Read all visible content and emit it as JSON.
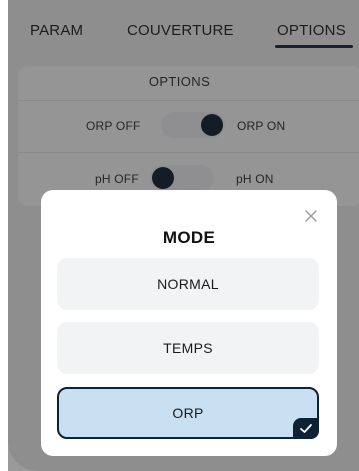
{
  "tabs": [
    {
      "label": "PARAM",
      "active": false
    },
    {
      "label": "COUVERTURE",
      "active": false
    },
    {
      "label": "OPTIONS",
      "active": true
    }
  ],
  "options": {
    "title": "OPTIONS",
    "orp": {
      "off_label": "ORP OFF",
      "on_label": "ORP ON",
      "state": "on"
    },
    "ph": {
      "off_label": "pH OFF",
      "on_label": "pH ON",
      "state": "off"
    }
  },
  "modal": {
    "title": "MODE",
    "close_icon": "close-icon",
    "modes": [
      {
        "label": "NORMAL",
        "selected": false
      },
      {
        "label": "TEMPS",
        "selected": false
      },
      {
        "label": "ORP",
        "selected": true
      }
    ],
    "selected_icon": "check-icon"
  },
  "colors": {
    "accent": "#0e2236",
    "selected_bg": "#c9dff2",
    "button_bg": "#f2f3f5",
    "screen_bg": "#e9eaec"
  }
}
